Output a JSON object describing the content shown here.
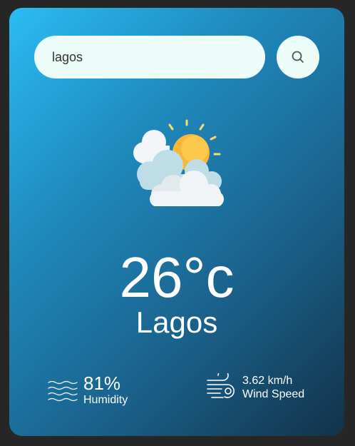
{
  "search": {
    "value": "lagos",
    "icon": "search-icon"
  },
  "weather": {
    "icon": "sun-behind-clouds-icon",
    "temperature": "26°c",
    "city": "Lagos"
  },
  "humidity": {
    "value": "81%",
    "label": "Humidity",
    "icon": "waves-icon"
  },
  "wind": {
    "value": "3.62 km/h",
    "label": "Wind Speed",
    "icon": "wind-icon"
  },
  "colors": {
    "gradient_start": "#2bbcf3",
    "gradient_end": "#123249",
    "input_background": "#ecfcf8",
    "page_background": "#262626",
    "sun": "#fbb537"
  }
}
